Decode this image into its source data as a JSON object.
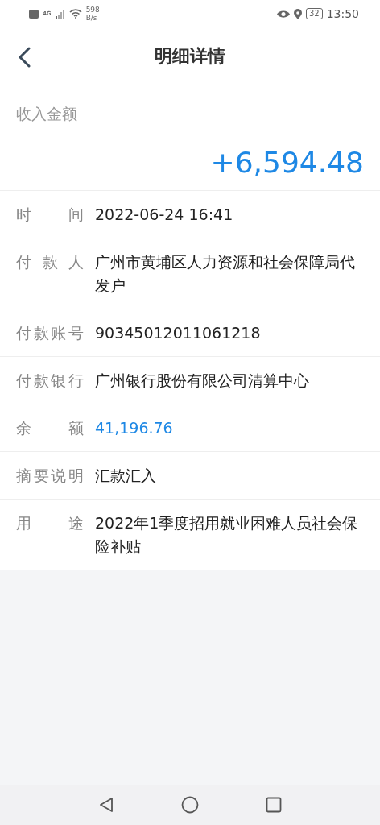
{
  "status_bar": {
    "network": "4G",
    "speed_value": "598",
    "speed_unit": "B/s",
    "battery": "32",
    "time": "13:50"
  },
  "header": {
    "title": "明细详情"
  },
  "amount": {
    "label": "收入金额",
    "value": "+6,594.48"
  },
  "details": [
    {
      "label": "时间",
      "value": "2022-06-24 16:41",
      "kind": "plain"
    },
    {
      "label": "付款人",
      "value": "广州市黄埔区人力资源和社会保障局代发户",
      "kind": "plain"
    },
    {
      "label": "付款账号",
      "value": "90345012011061218",
      "kind": "plain"
    },
    {
      "label": "付款银行",
      "value": "广州银行股份有限公司清算中心",
      "kind": "plain"
    },
    {
      "label": "余额",
      "value": "41,196.76",
      "kind": "money"
    },
    {
      "label": "摘要说明",
      "value": "汇款汇入",
      "kind": "plain"
    },
    {
      "label": "用途",
      "value": "2022年1季度招用就业困难人员社会保险补贴",
      "kind": "plain"
    }
  ]
}
